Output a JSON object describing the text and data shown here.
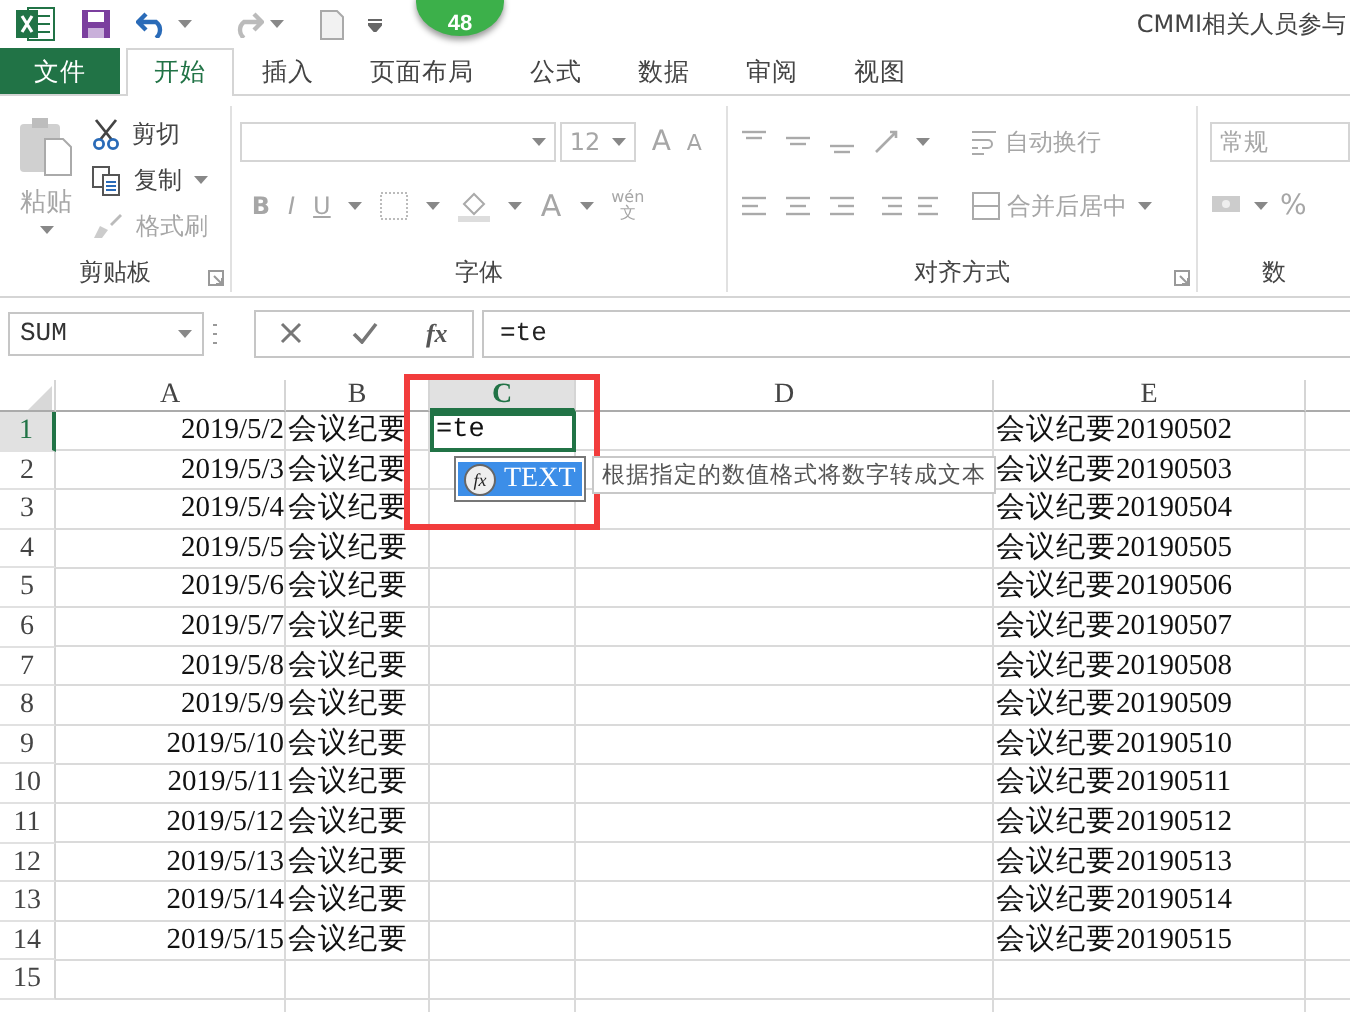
{
  "title_bar": {
    "title": "CMMI相关人员参与",
    "badge": "48"
  },
  "menu_tabs": [
    {
      "label": "文件",
      "selected": false,
      "kind": "file"
    },
    {
      "label": "开始",
      "selected": true,
      "kind": "tab"
    },
    {
      "label": "插入",
      "selected": false,
      "kind": "tab"
    },
    {
      "label": "页面布局",
      "selected": false,
      "kind": "tab"
    },
    {
      "label": "公式",
      "selected": false,
      "kind": "tab"
    },
    {
      "label": "数据",
      "selected": false,
      "kind": "tab"
    },
    {
      "label": "审阅",
      "selected": false,
      "kind": "tab"
    },
    {
      "label": "视图",
      "selected": false,
      "kind": "tab"
    }
  ],
  "ribbon": {
    "clipboard": {
      "paste": "粘贴",
      "cut": "剪切",
      "copy": "复制",
      "format_painter": "格式刷",
      "label": "剪贴板"
    },
    "font": {
      "size": "12",
      "grow": "A",
      "shrink": "A",
      "bold": "B",
      "italic": "I",
      "underline": "U",
      "font_color": "A",
      "phonetic_top": "wén",
      "phonetic_bottom": "文",
      "label": "字体"
    },
    "alignment": {
      "wrap_text": "自动换行",
      "merge_center": "合并后居中",
      "label": "对齐方式"
    },
    "number": {
      "format": "常规",
      "percent": "%",
      "label": "数"
    }
  },
  "formula_bar": {
    "name_box": "SUM",
    "function_label": "fx",
    "value": "=te"
  },
  "grid": {
    "columns": [
      {
        "label": "A",
        "selected": false
      },
      {
        "label": "B",
        "selected": false
      },
      {
        "label": "C",
        "selected": true
      },
      {
        "label": "D",
        "selected": false
      },
      {
        "label": "E",
        "selected": false
      }
    ],
    "rows": [
      {
        "number": "1",
        "selected": true,
        "cells": {
          "A": "2019/5/2",
          "B": "会议纪要",
          "C": "=te",
          "E": "会议纪要20190502"
        }
      },
      {
        "number": "2",
        "selected": false,
        "cells": {
          "A": "2019/5/3",
          "B": "会议纪要",
          "E": "会议纪要20190503"
        }
      },
      {
        "number": "3",
        "selected": false,
        "cells": {
          "A": "2019/5/4",
          "B": "会议纪要",
          "E": "会议纪要20190504"
        }
      },
      {
        "number": "4",
        "selected": false,
        "cells": {
          "A": "2019/5/5",
          "B": "会议纪要",
          "E": "会议纪要20190505"
        }
      },
      {
        "number": "5",
        "selected": false,
        "cells": {
          "A": "2019/5/6",
          "B": "会议纪要",
          "E": "会议纪要20190506"
        }
      },
      {
        "number": "6",
        "selected": false,
        "cells": {
          "A": "2019/5/7",
          "B": "会议纪要",
          "E": "会议纪要20190507"
        }
      },
      {
        "number": "7",
        "selected": false,
        "cells": {
          "A": "2019/5/8",
          "B": "会议纪要",
          "E": "会议纪要20190508"
        }
      },
      {
        "number": "8",
        "selected": false,
        "cells": {
          "A": "2019/5/9",
          "B": "会议纪要",
          "E": "会议纪要20190509"
        }
      },
      {
        "number": "9",
        "selected": false,
        "cells": {
          "A": "2019/5/10",
          "B": "会议纪要",
          "E": "会议纪要20190510"
        }
      },
      {
        "number": "10",
        "selected": false,
        "cells": {
          "A": "2019/5/11",
          "B": "会议纪要",
          "E": "会议纪要20190511"
        }
      },
      {
        "number": "11",
        "selected": false,
        "cells": {
          "A": "2019/5/12",
          "B": "会议纪要",
          "E": "会议纪要20190512"
        }
      },
      {
        "number": "12",
        "selected": false,
        "cells": {
          "A": "2019/5/13",
          "B": "会议纪要",
          "E": "会议纪要20190513"
        }
      },
      {
        "number": "13",
        "selected": false,
        "cells": {
          "A": "2019/5/14",
          "B": "会议纪要",
          "E": "会议纪要20190514"
        }
      },
      {
        "number": "14",
        "selected": false,
        "cells": {
          "A": "2019/5/15",
          "B": "会议纪要",
          "E": "会议纪要20190515"
        }
      },
      {
        "number": "15",
        "selected": false,
        "cells": {}
      }
    ]
  },
  "autocomplete": {
    "function_label": "fx",
    "items": [
      {
        "label": "TEXT",
        "selected": true
      }
    ],
    "tooltip": "根据指定的数值格式将数字转成文本"
  }
}
